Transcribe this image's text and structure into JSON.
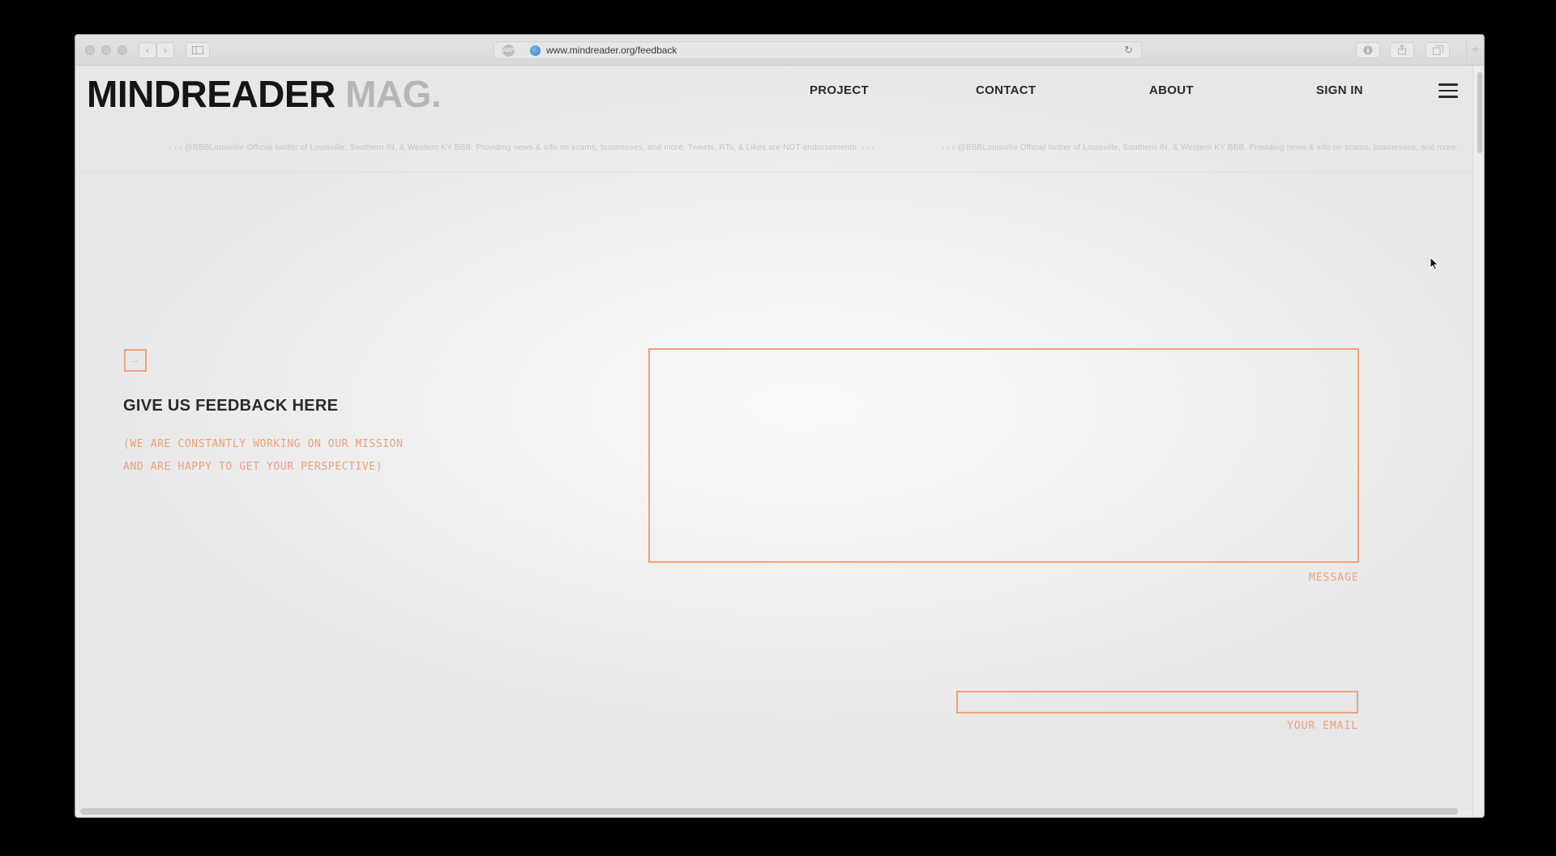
{
  "browser": {
    "url": "www.mindreader.org/feedback",
    "back_glyph": "‹",
    "forward_glyph": "›",
    "reload_glyph": "↻",
    "new_tab_glyph": "+",
    "reader_badge": "ABP"
  },
  "site": {
    "logo_main": "MINDREADER",
    "logo_accent": "MAG.",
    "nav": [
      {
        "label": "PROJECT"
      },
      {
        "label": "CONTACT"
      },
      {
        "label": "ABOUT"
      },
      {
        "label": "SIGN IN"
      }
    ],
    "ticker": [
      "› › › @BBBLouisville Official twitter of Louisville, Southern IN, & Western KY BBB. Providing news & info on scams, businesses, and more. Tweets, RTs, & Likes are NOT endorsements. › › ›",
      "› › › @BBBLouisville Official twitter of Louisville, Southern IN, & Western KY BBB. Providing news & info on scams, businesses, and more."
    ]
  },
  "feedback": {
    "arrow_glyph": "→",
    "title": "GIVE US FEEDBACK HERE",
    "subtitle": "(WE ARE CONSTANTLY WORKING ON OUR MISSION\nAND ARE HAPPY TO GET YOUR PERSPECTIVE)",
    "message_label": "MESSAGE",
    "message_value": "",
    "email_label": "YOUR EMAIL",
    "email_value": ""
  },
  "colors": {
    "accent": "#f0a07a",
    "text_dark": "#2a2a2a",
    "logo_gray": "#b6b6b6"
  },
  "icons": {
    "menu": "hamburger-icon",
    "cursor": "mouse-pointer-icon",
    "site": "globe-icon"
  }
}
